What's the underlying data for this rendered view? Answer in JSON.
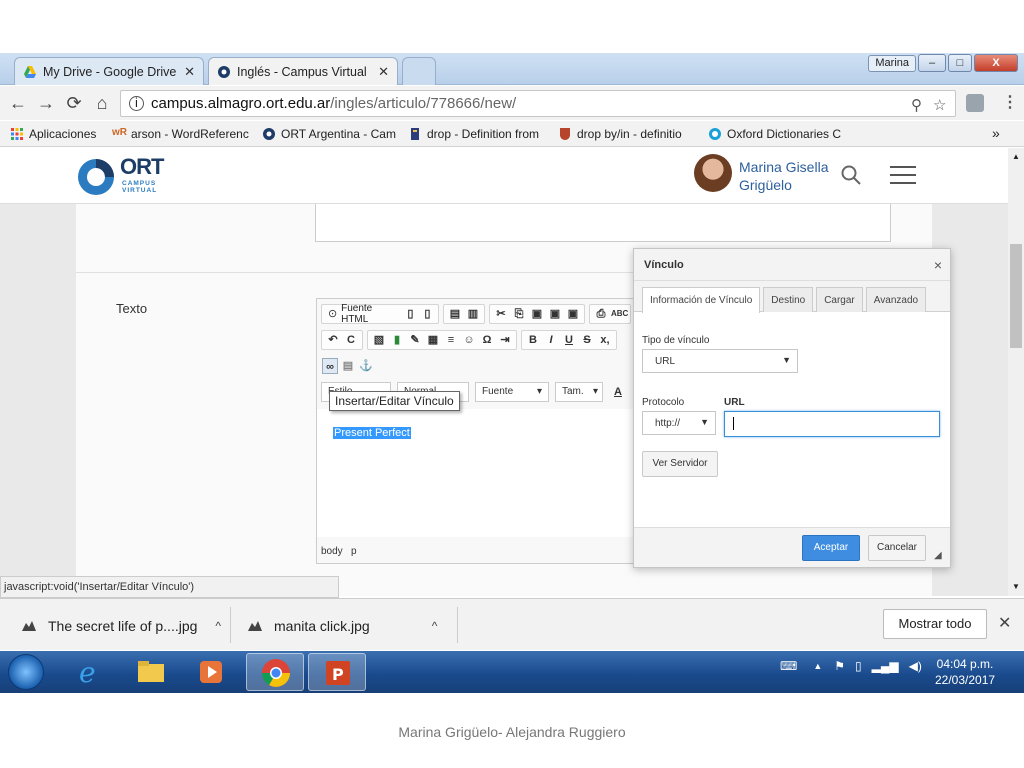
{
  "browser": {
    "tabs": [
      {
        "label": "My Drive - Google Drive",
        "icon": "google-drive-icon"
      },
      {
        "label": "Inglés - Campus Virtual ",
        "icon": "ort-icon",
        "active": true
      }
    ],
    "profile_name": "Marina",
    "window_buttons": {
      "minimize": "–",
      "maximize": "□",
      "close": "X"
    },
    "address": {
      "host": "campus.almagro.ort.edu.ar",
      "path": "/ingles/articulo/778666/new/"
    },
    "bookmarks": [
      {
        "label": "Aplicaciones",
        "icon": "apps-grid-icon"
      },
      {
        "label": "arson - WordReferenc",
        "icon": "wordreference-icon"
      },
      {
        "label": "ORT Argentina - Cam",
        "icon": "ort-icon"
      },
      {
        "label": "drop - Definition from",
        "icon": "merriam-icon"
      },
      {
        "label": "drop by/in - definitio",
        "icon": "cambridge-icon"
      },
      {
        "label": "Oxford Dictionaries C",
        "icon": "oxford-icon"
      }
    ],
    "bookmarks_overflow": "»"
  },
  "site": {
    "logo_text": "ORT",
    "logo_sub_1": "CAMPUS",
    "logo_sub_2": "VIRTUAL",
    "user_first": "Marina Gisella",
    "user_last": "Grigüelo"
  },
  "form": {
    "field_label": "Texto",
    "editor": {
      "toolbar_source": "Fuente HTML",
      "combos": [
        "Estilo",
        "Normal",
        "Fuente",
        "Tam."
      ],
      "selected_text": "Present Perfect",
      "status_path": [
        "body",
        "p"
      ],
      "tooltip": "Insertar/Editar Vínculo"
    }
  },
  "dialog": {
    "title": "Vínculo",
    "close": "×",
    "tabs": [
      "Información de Vínculo",
      "Destino",
      "Cargar",
      "Avanzado"
    ],
    "link_type_label": "Tipo de vínculo",
    "link_type_value": "URL",
    "protocol_label": "Protocolo",
    "protocol_value": "http://",
    "url_label": "URL",
    "url_value": "",
    "browse_server": "Ver Servidor",
    "ok": "Aceptar",
    "cancel": "Cancelar"
  },
  "status_url": "javascript:void('Insertar/Editar Vínculo')",
  "downloads": {
    "items": [
      "The secret life of p....jpg",
      "manita click.jpg"
    ],
    "show_all": "Mostrar todo"
  },
  "taskbar": {
    "time": "04:04 p.m.",
    "date": "22/03/2017"
  },
  "caption": "Marina Grigüelo- Alejandra Ruggiero"
}
